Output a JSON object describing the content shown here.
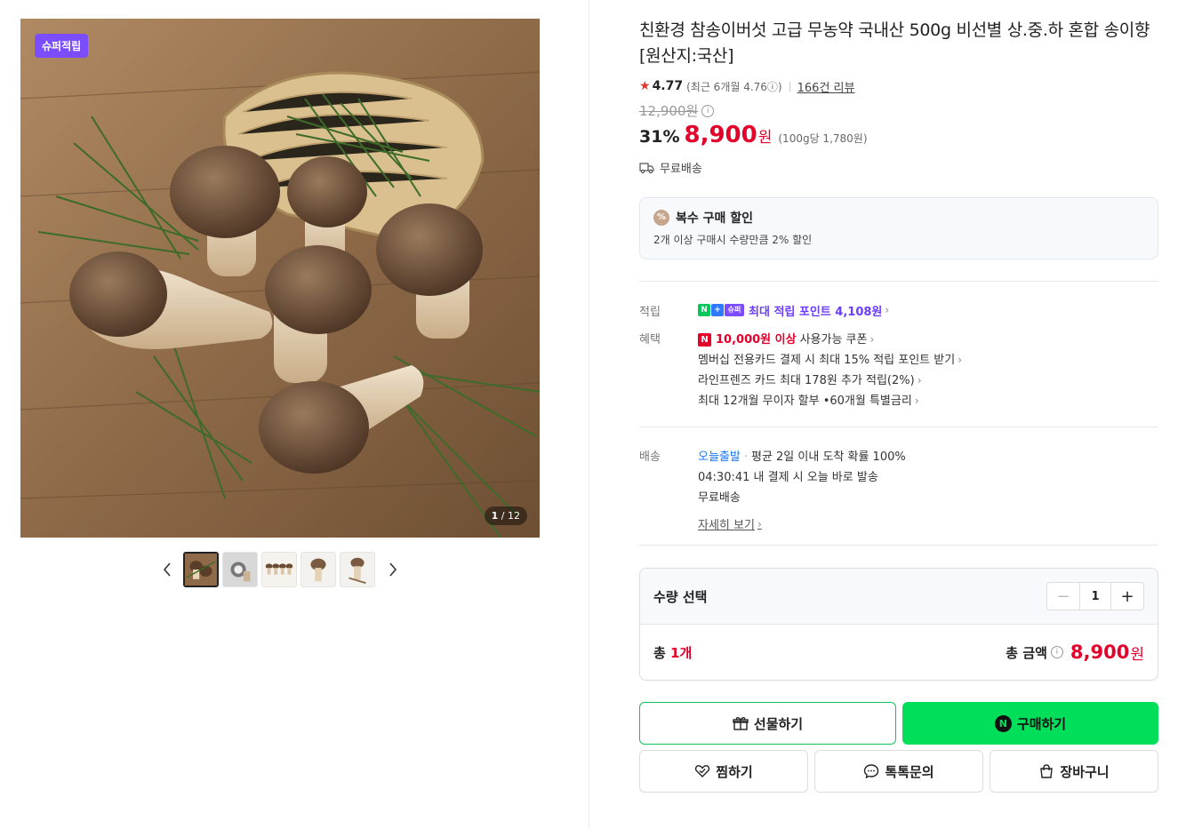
{
  "gallery": {
    "badge": "슈퍼적립",
    "counter_current": "1",
    "counter_total": "/ 12"
  },
  "product": {
    "title": "친환경 참송이버섯 고급 무농약 국내산 500g 비선별 상.중.하 혼합 송이향 [원산지:국산]",
    "rating": "4.77",
    "recent_rating": "(최근 6개월 4.76ⓘ)",
    "review_count": "166건 리뷰",
    "original_price": "12,900원",
    "discount": "31%",
    "price": "8,900",
    "price_unit": "원",
    "unit_price": "(100g당 1,780원)",
    "shipping": "무료배송"
  },
  "multi_discount": {
    "title": "복수 구매 할인",
    "desc": "2개 이상 구매시 수량만큼 2% 할인"
  },
  "points": {
    "label": "적립",
    "text": "최대 적립 포인트 4,108원"
  },
  "benefits": {
    "label": "혜택",
    "coupon_amount": "10,000원 이상",
    "coupon_text": "사용가능 쿠폰",
    "line2": "멤버십 전용카드 결제 시 최대 15% 적립 포인트 받기",
    "line3": "라인프렌즈 카드 최대 178원 추가 적립(2%)",
    "line4": "최대 12개월 무이자 할부 •60개월 특별금리"
  },
  "delivery": {
    "label": "배송",
    "today": "오늘출발",
    "today_desc": "평균 2일 이내 도착 확률 100%",
    "countdown": "04:30:41  내 결제 시 오늘 바로 발송",
    "free": "무료배송",
    "detail_link": "자세히 보기"
  },
  "quantity": {
    "label": "수량 선택",
    "value": "1",
    "total_prefix": "총 ",
    "total_count": "1개",
    "total_label": "총 금액",
    "total_price": "8,900",
    "total_unit": "원"
  },
  "buttons": {
    "gift": "선물하기",
    "buy": "구매하기",
    "wish": "찜하기",
    "talk": "톡톡문의",
    "cart": "장바구니"
  },
  "colors": {
    "price_red": "#e3002b",
    "buy_green": "#00de5a",
    "point_purple": "#6b3dff",
    "today_blue": "#1877f2"
  }
}
